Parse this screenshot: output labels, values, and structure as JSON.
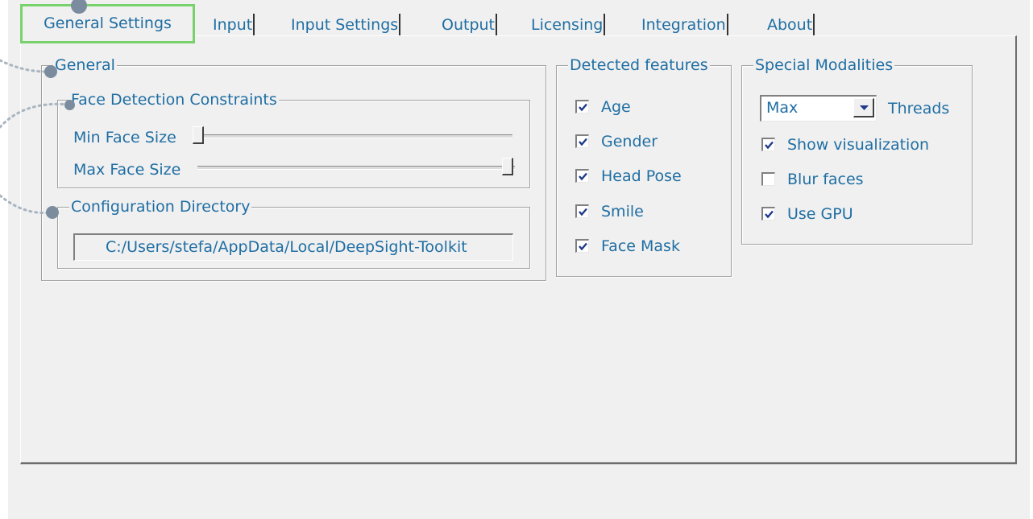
{
  "tabs": [
    {
      "label": "General Settings",
      "active": true
    },
    {
      "label": "Input"
    },
    {
      "label": "Input Settings"
    },
    {
      "label": "Output"
    },
    {
      "label": "Licensing"
    },
    {
      "label": "Integration"
    },
    {
      "label": "About"
    }
  ],
  "general": {
    "title": "General",
    "face_detection": {
      "title": "Face Detection Constraints",
      "min_label": "Min Face Size",
      "max_label": "Max Face Size",
      "min_value_fraction": 0.0,
      "max_value_fraction": 1.0
    },
    "config_dir": {
      "title": "Configuration Directory",
      "path": "C:/Users/stefa/AppData/Local/DeepSight-Toolkit"
    }
  },
  "detected_features": {
    "title": "Detected features",
    "items": [
      {
        "label": "Age",
        "checked": true
      },
      {
        "label": "Gender",
        "checked": true
      },
      {
        "label": "Head Pose",
        "checked": true
      },
      {
        "label": "Smile",
        "checked": true
      },
      {
        "label": "Face Mask",
        "checked": true
      }
    ]
  },
  "special_modalities": {
    "title": "Special Modalities",
    "threads_value": "Max",
    "threads_label": "Threads",
    "items": [
      {
        "label": "Show visualization",
        "checked": true
      },
      {
        "label": "Blur faces",
        "checked": false
      },
      {
        "label": "Use GPU",
        "checked": true
      }
    ]
  },
  "colors": {
    "text": "#1f6ea3",
    "highlight": "#78d26b",
    "annotation_dot": "#7a8c9e",
    "background": "#f0f0f0"
  }
}
